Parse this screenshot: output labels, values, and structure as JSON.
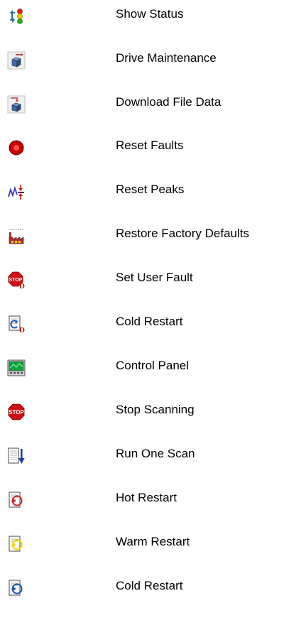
{
  "items": [
    {
      "label": "Show Status",
      "icon": "status-icon"
    },
    {
      "label": "Drive Maintenance",
      "icon": "drive-maintenance-icon"
    },
    {
      "label": "Download File Data",
      "icon": "download-file-data-icon"
    },
    {
      "label": "Reset Faults",
      "icon": "reset-faults-icon"
    },
    {
      "label": "Reset Peaks",
      "icon": "reset-peaks-icon"
    },
    {
      "label": "Restore Factory Defaults",
      "icon": "factory-icon"
    },
    {
      "label": "Set User Fault",
      "icon": "stop-d-icon"
    },
    {
      "label": "Cold Restart",
      "icon": "cold-restart-d-icon"
    },
    {
      "label": "Control Panel",
      "icon": "control-panel-icon"
    },
    {
      "label": "Stop Scanning",
      "icon": "stop-icon"
    },
    {
      "label": "Run One Scan",
      "icon": "run-one-scan-icon"
    },
    {
      "label": "Hot Restart",
      "icon": "hot-restart-icon"
    },
    {
      "label": "Warm Restart",
      "icon": "warm-restart-icon"
    },
    {
      "label": "Cold Restart",
      "icon": "cold-restart-icon"
    }
  ]
}
